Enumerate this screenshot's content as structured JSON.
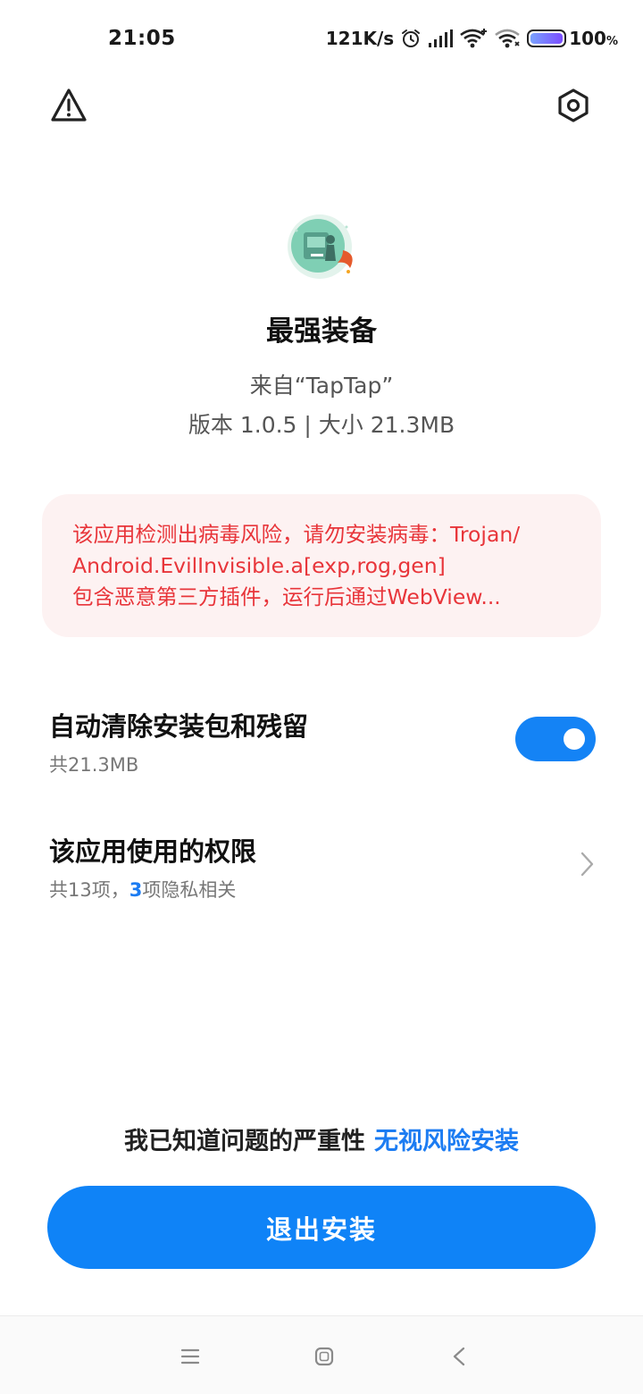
{
  "status_bar": {
    "time": "21:05",
    "net_speed": "121K/s",
    "icons": [
      "alarm-icon",
      "signal-icon",
      "wifi-plus-icon",
      "wifi-icon",
      "battery-icon"
    ],
    "battery_level": 1.0,
    "battery_text": "100",
    "battery_unit": "%"
  },
  "toolbar": {
    "warning_icon": "warning-triangle-icon",
    "settings_icon": "settings-hexagon-icon"
  },
  "app": {
    "name": "最强装备",
    "source": "来自“TapTap”",
    "version_size": "版本 1.0.5 | 大小 21.3MB",
    "icon_colors": {
      "bg": "#7fcfb4",
      "accent": "#e55a2c"
    }
  },
  "warning": {
    "line1": "该应用检测出病毒风险，请勿安装病毒：Trojan/",
    "line2": "Android.EvilInvisible.a[exp,rog,gen]",
    "line3": "包含恶意第三方插件，运行后通过WebView...",
    "text_color": "#e8353a",
    "bg_color": "#fdf2f2"
  },
  "auto_clean": {
    "title": "自动清除安装包和残留",
    "subtitle": "共21.3MB",
    "enabled": true
  },
  "permissions": {
    "title": "该应用使用的权限",
    "subtitle_prefix": "共13项，",
    "privacy_count": "3",
    "subtitle_suffix": "项隐私相关"
  },
  "bottom": {
    "ignore_text": "我已知道问题的严重性",
    "ignore_link": "无视风险安装",
    "exit_button": "退出安装",
    "accent_color": "#0f83f7"
  },
  "nav_bar": {
    "buttons": [
      "menu-icon",
      "home-icon",
      "back-icon"
    ]
  }
}
